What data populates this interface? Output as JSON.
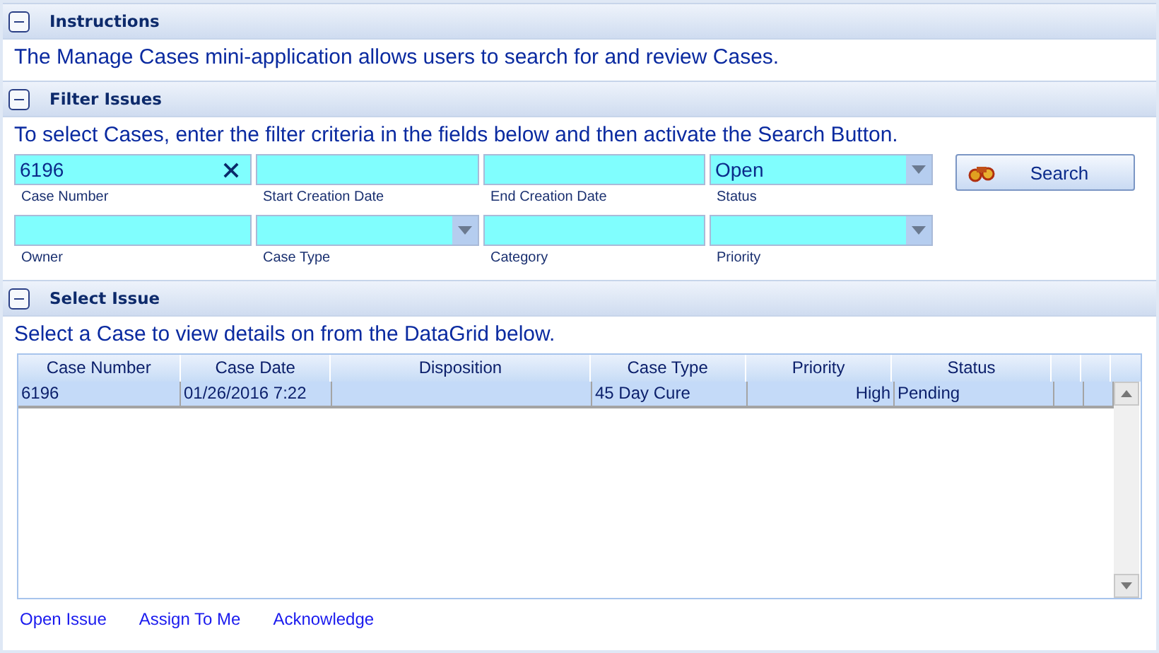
{
  "sections": [
    {
      "title": "Instructions",
      "expanded": true,
      "text": "The Manage Cases mini-application allows users to search for and review Cases."
    },
    {
      "title": "Filter Issues",
      "expanded": true,
      "text": "To select Cases, enter the filter criteria in the fields below and then activate the Search Button."
    },
    {
      "title": "Select Issue",
      "expanded": true,
      "text": "Select a Case to view details on from the DataGrid below."
    }
  ],
  "filters": [
    [
      {
        "kind": "text",
        "label": "Case Number",
        "value": "6196",
        "clearable": true
      },
      {
        "kind": "text",
        "label": "Start Creation Date"
      },
      {
        "kind": "text",
        "label": "End Creation Date"
      },
      {
        "kind": "dropdown",
        "label": "Status",
        "value": "Open"
      }
    ],
    [
      {
        "kind": "text",
        "label": "Owner"
      },
      {
        "kind": "dropdown",
        "label": "Case Type"
      },
      {
        "kind": "text",
        "label": "Category"
      },
      {
        "kind": "dropdown",
        "label": "Priority"
      }
    ]
  ],
  "search_button": "Search",
  "table": {
    "columns": [
      "Case Number",
      "Case Date",
      "Disposition",
      "Case Type",
      "Priority",
      "Status"
    ],
    "rows": [
      {
        "selected": true,
        "cells": [
          "6196",
          "01/26/2016 7:22",
          "",
          "45 Day Cure",
          "High",
          "Pending"
        ]
      }
    ]
  },
  "links": [
    "Open Issue",
    "Assign To Me",
    "Acknowledge"
  ]
}
